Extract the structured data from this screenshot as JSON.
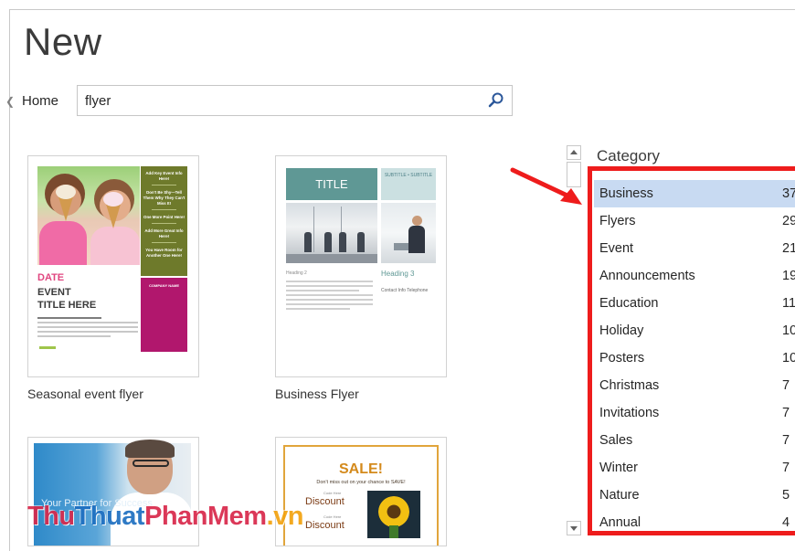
{
  "page": {
    "title": "New"
  },
  "nav": {
    "home_label": "Home"
  },
  "search": {
    "value": "flyer"
  },
  "templates": [
    {
      "caption": "Seasonal event flyer"
    },
    {
      "caption": "Business Flyer"
    }
  ],
  "thumb_seasonal": {
    "date": "DATE",
    "event_line1": "EVENT",
    "event_line2": "TITLE HERE",
    "sidebar": [
      "Add Key Event Info Here!",
      "Don't Be Shy—Tell Them Why They Can't Miss It!",
      "One More Point Here!",
      "Add More Great Info Here!",
      "You Have Room for Another One Here!"
    ],
    "company": "COMPANY NAME"
  },
  "thumb_business": {
    "title": "TITLE",
    "subtitle": "SUBTITLE • SUBTITLE",
    "heading2": "Heading 2",
    "heading3": "Heading 3",
    "contact": "Contact Info Telephone"
  },
  "thumb_portrait": {
    "tagline1": "Your Partner for Success",
    "tagline2": ""
  },
  "thumb_sale": {
    "title": "SALE!",
    "subtitle": "Don't miss out on your chance to SAVE!",
    "discount1": "Discount",
    "discount2": "Discount",
    "small1": "Code Here",
    "small2": "Code Here"
  },
  "category": {
    "heading": "Category",
    "items": [
      {
        "name": "Business",
        "count": "37"
      },
      {
        "name": "Flyers",
        "count": "29"
      },
      {
        "name": "Event",
        "count": "21"
      },
      {
        "name": "Announcements",
        "count": "19"
      },
      {
        "name": "Education",
        "count": "11"
      },
      {
        "name": "Holiday",
        "count": "10"
      },
      {
        "name": "Posters",
        "count": "10"
      },
      {
        "name": "Christmas",
        "count": "7"
      },
      {
        "name": "Invitations",
        "count": "7"
      },
      {
        "name": "Sales",
        "count": "7"
      },
      {
        "name": "Winter",
        "count": "7"
      },
      {
        "name": "Nature",
        "count": "5"
      },
      {
        "name": "Annual",
        "count": "4"
      }
    ]
  },
  "watermark": {
    "part1": "Thu",
    "part2": "Thuat",
    "part3": "PhanMem",
    "part4": ".vn"
  },
  "colors": {
    "selected_bg": "#c8daf2",
    "highlight": "#ee1c1c",
    "accent": "#2b579a"
  }
}
